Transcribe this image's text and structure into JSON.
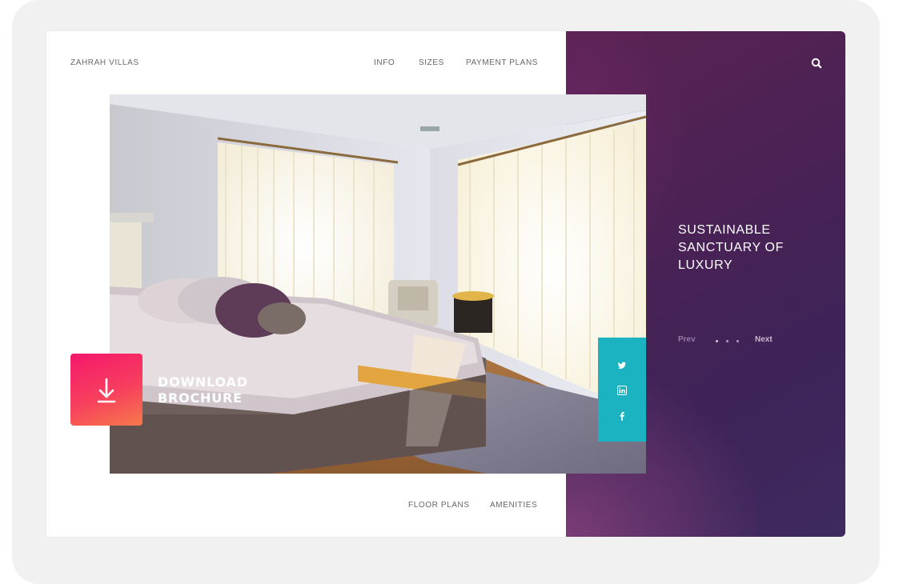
{
  "brand": "ZAHRAH VILLAS",
  "nav": {
    "info": "INFO",
    "sizes": "SIZES",
    "payment_plans": "PAYMENT PLANS"
  },
  "hero": {
    "tagline": "SUSTAINABLE SANCTUARY OF LUXURY",
    "slider": {
      "prev": "Prev",
      "next": "Next"
    }
  },
  "download": {
    "label": "DOWNLOAD BROCHURE"
  },
  "footer_nav": {
    "floor_plans": "FLOOR PLANS",
    "amenities": "AMENITIES"
  },
  "social": [
    "twitter-icon",
    "linkedin-icon",
    "facebook-icon"
  ],
  "colors": {
    "panel_purple": "#4a2255",
    "social_teal": "#1bb3c2",
    "download_pink": "#f5176c",
    "download_orange": "#f7794a"
  }
}
